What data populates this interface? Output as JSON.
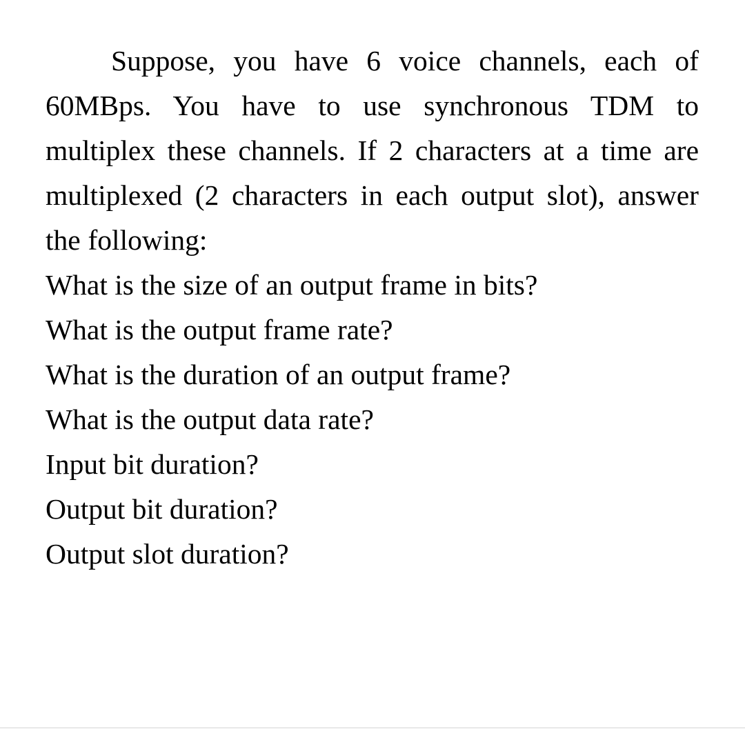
{
  "document": {
    "background_color": "#ffffff",
    "text_color": "#000000",
    "problem_statement": "Suppose, you have 6 voice channels, each of 60MBps. You have to use synchronous TDM to multiplex these channels. If 2 characters at a time are multiplexed (2 characters in each output slot), answer the following:",
    "questions": [
      "What is the size of an output frame in bits?",
      "What is the output frame rate?",
      "What is the duration of an output frame?",
      "What is the output data rate?",
      "Input bit duration?",
      "Output bit duration?",
      "Output slot duration?"
    ],
    "divider_color": "#d4d4d4"
  }
}
